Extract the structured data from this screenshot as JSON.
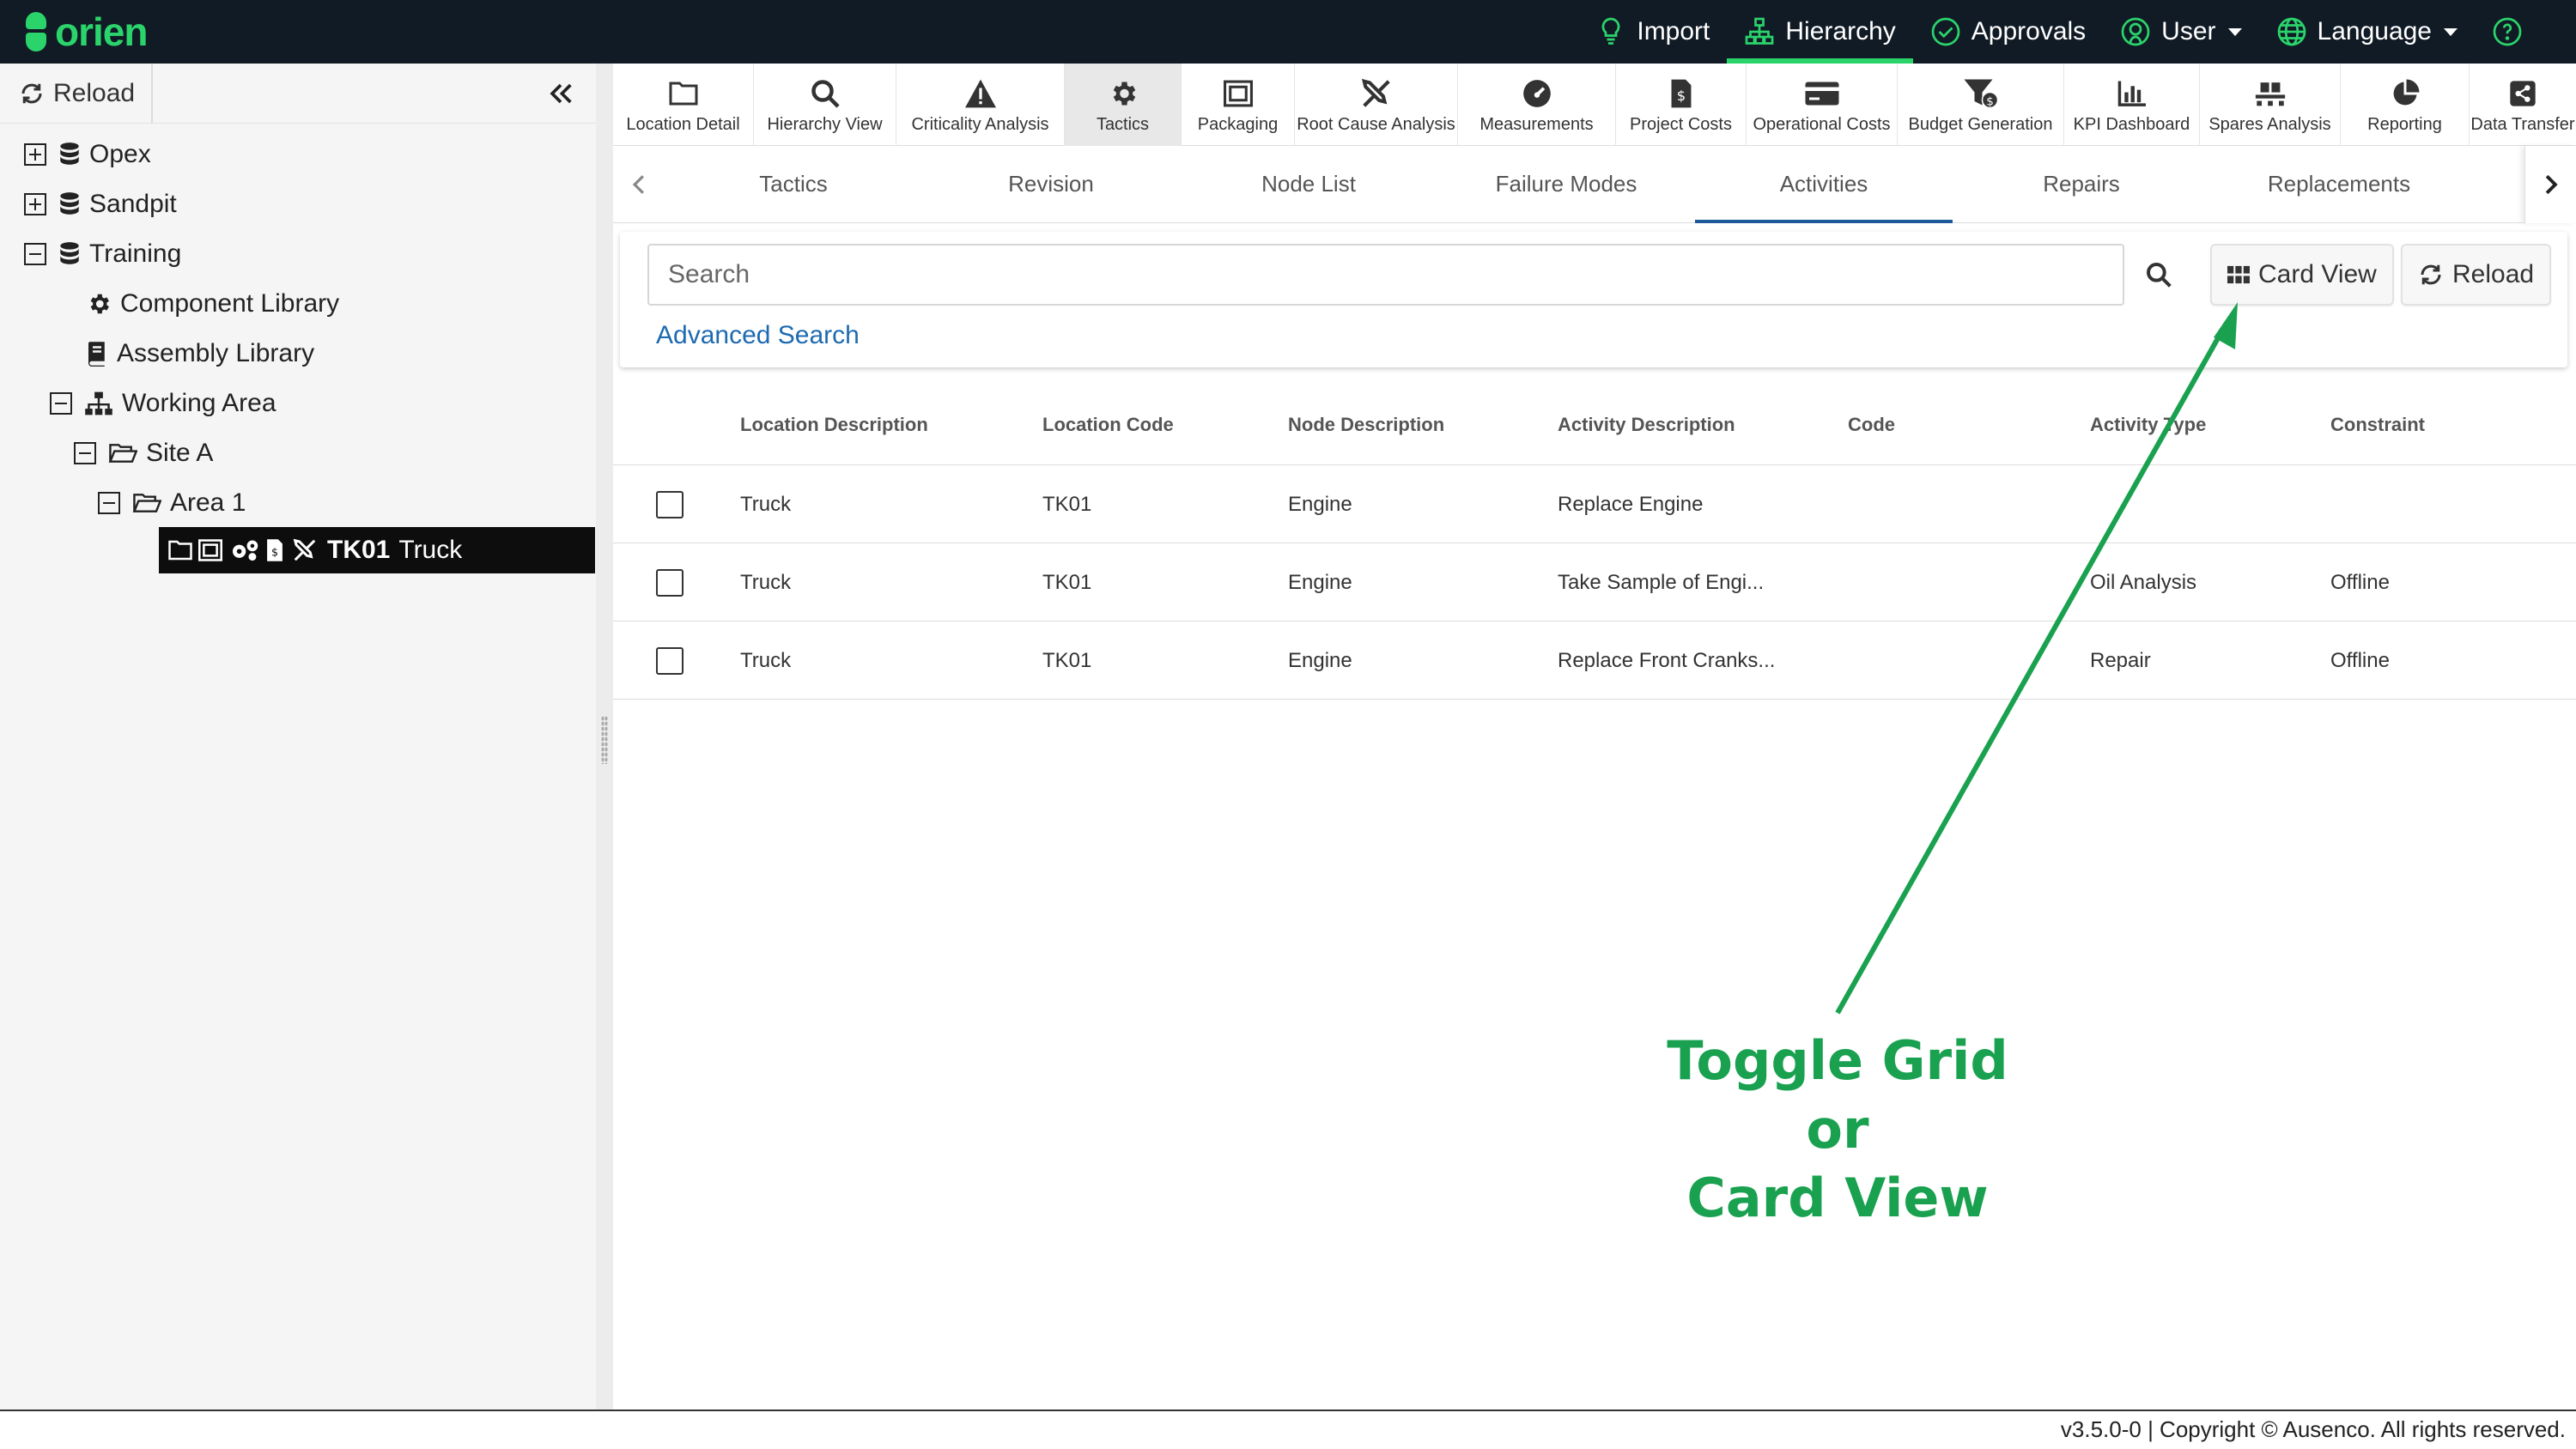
{
  "app": {
    "logo_text": "orien",
    "accent_color": "#2bd46b",
    "nav_bg": "#111b26"
  },
  "topnav": {
    "items": [
      {
        "label": "Import",
        "icon": "lightbulb-icon"
      },
      {
        "label": "Hierarchy",
        "icon": "hierarchy-icon",
        "active": true
      },
      {
        "label": "Approvals",
        "icon": "check-circle-icon"
      },
      {
        "label": "User",
        "icon": "user-icon",
        "dropdown": true
      },
      {
        "label": "Language",
        "icon": "globe-icon",
        "dropdown": true
      },
      {
        "label": "",
        "icon": "help-icon"
      }
    ]
  },
  "left": {
    "reload_label": "Reload",
    "tree": [
      {
        "label": "Opex",
        "icon": "database-icon",
        "expander": "plus"
      },
      {
        "label": "Sandpit",
        "icon": "database-icon",
        "expander": "plus"
      },
      {
        "label": "Training",
        "icon": "database-icon",
        "expander": "minus"
      },
      {
        "label": "Component Library",
        "icon": "gear-icon"
      },
      {
        "label": "Assembly Library",
        "icon": "book-icon"
      },
      {
        "label": "Working Area",
        "icon": "sitemap-icon",
        "expander": "minus"
      },
      {
        "label": "Site A",
        "icon": "folder-open-icon",
        "expander": "minus"
      },
      {
        "label": "Area 1",
        "icon": "folder-open-icon",
        "expander": "minus"
      },
      {
        "code": "TK01",
        "label": "Truck",
        "selected": true
      }
    ]
  },
  "modules": [
    {
      "label": "Location Detail",
      "icon": "folder-icon"
    },
    {
      "label": "Hierarchy View",
      "icon": "search-icon"
    },
    {
      "label": "Criticality Analysis",
      "icon": "warning-icon"
    },
    {
      "label": "Tactics",
      "icon": "gear-icon",
      "active": true
    },
    {
      "label": "Packaging",
      "icon": "package-icon"
    },
    {
      "label": "Root Cause Analysis",
      "icon": "tools-icon"
    },
    {
      "label": "Measurements",
      "icon": "gauge-icon"
    },
    {
      "label": "Project Costs",
      "icon": "invoice-icon"
    },
    {
      "label": "Operational Costs",
      "icon": "credit-card-icon"
    },
    {
      "label": "Budget Generation",
      "icon": "funnel-dollar-icon"
    },
    {
      "label": "KPI Dashboard",
      "icon": "bar-chart-icon"
    },
    {
      "label": "Spares Analysis",
      "icon": "pallet-icon"
    },
    {
      "label": "Reporting",
      "icon": "pie-chart-icon"
    },
    {
      "label": "Data Transfer",
      "icon": "share-icon"
    }
  ],
  "tabs": [
    "Tactics",
    "Revision",
    "Node List",
    "Failure Modes",
    "Activities",
    "Repairs",
    "Replacements"
  ],
  "active_tab": "Activities",
  "search": {
    "placeholder": "Search",
    "advanced_label": "Advanced Search",
    "card_view_label": "Card View",
    "reload_label": "Reload"
  },
  "grid": {
    "columns": [
      "Location Description",
      "Location Code",
      "Node Description",
      "Activity Description",
      "Code",
      "Activity Type",
      "Constraint"
    ],
    "rows": [
      [
        "Truck",
        "TK01",
        "Engine",
        "Replace Engine",
        "",
        "",
        ""
      ],
      [
        "Truck",
        "TK01",
        "Engine",
        "Take Sample of Engi...",
        "",
        "Oil Analysis",
        "Offline"
      ],
      [
        "Truck",
        "TK01",
        "Engine",
        "Replace Front Cranks...",
        "",
        "Repair",
        "Offline"
      ]
    ]
  },
  "annotation": {
    "line1": "Toggle Grid or",
    "line2": "Card View",
    "color": "#1aa150"
  },
  "footer": {
    "text": "v3.5.0-0 | Copyright © Ausenco. All rights reserved."
  }
}
